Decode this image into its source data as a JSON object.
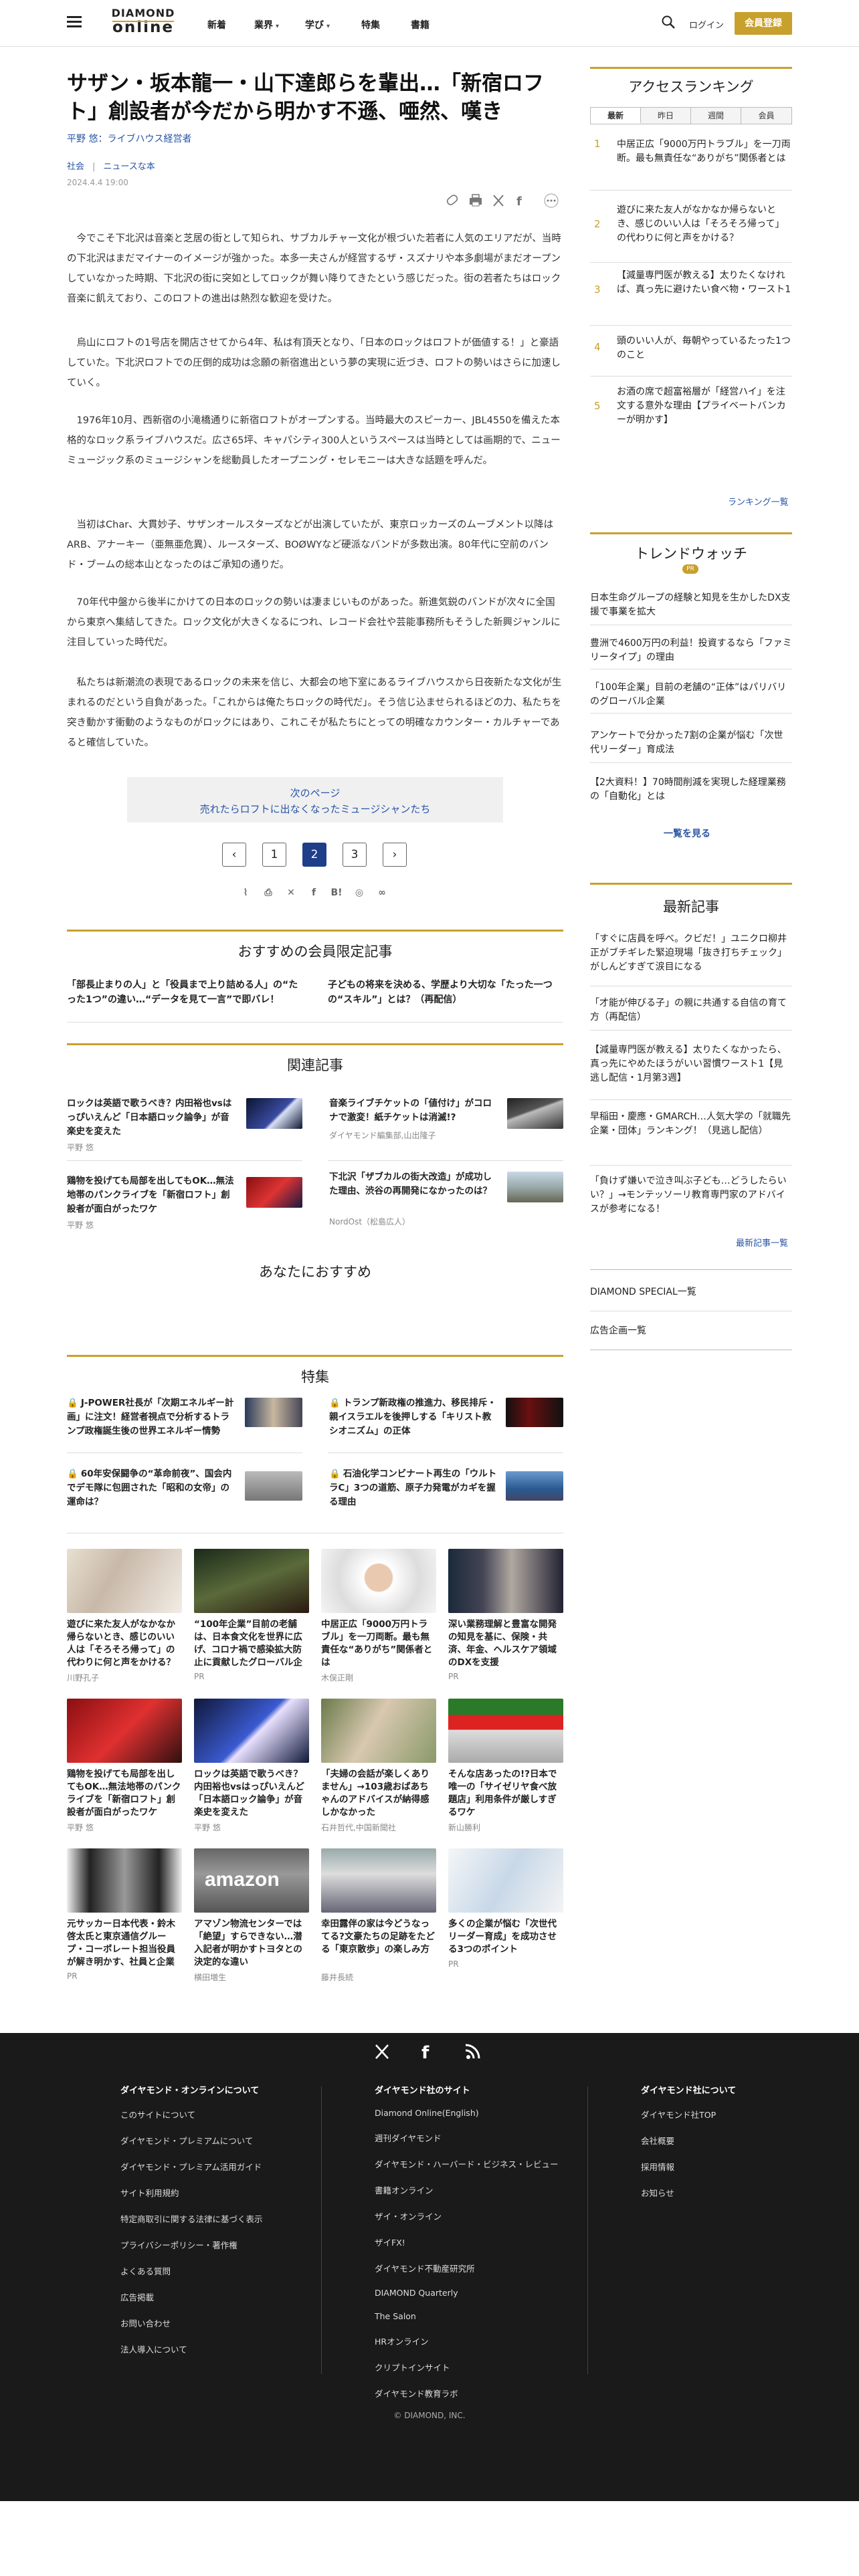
{
  "header": {
    "logo_top": "DIAMOND",
    "logo_bottom": "online",
    "nav": [
      "新着",
      "業界",
      "学び",
      "特集",
      "書籍"
    ],
    "login": "ログイン",
    "register": "会員登録"
  },
  "article": {
    "title": "サザン・坂本龍一・山下達郎らを輩出…「新宿ロフト」創設者が今だから明かす不遜、唖然、嘆き",
    "author": "平野 悠：ライブハウス経営者",
    "categories": [
      "社会",
      "ニュースな本"
    ],
    "date": "2024.4.4 19:00",
    "paragraphs": [
      "今でこそ下北沢は音楽と芝居の街として知られ、サブカルチャー文化が根づいた若者に人気のエリアだが、当時の下北沢はまだマイナーのイメージが強かった。本多一夫さんが経営するザ・スズナリや本多劇場がまだオープンしていなかった時期、下北沢の街に突如としてロックが舞い降りてきたという感じだった。街の若者たちはロック音楽に飢えており、このロフトの進出は熱烈な歓迎を受けた。",
      "烏山にロフトの1号店を開店させてから4年、私は有頂天となり、「日本のロックはロフトが価値する！」と豪語していた。下北沢ロフトでの圧倒的成功は念願の新宿進出という夢の実現に近づき、ロフトの勢いはさらに加速していく。",
      "1976年10月、西新宿の小滝橋通りに新宿ロフトがオープンする。当時最大のスピーカー、JBL4550を備えた本格的なロック系ライブハウスだ。広さ65坪、キャパシティ300人というスペースは当時としては画期的で、ニューミュージック系のミュージシャンを総動員したオープニング・セレモニーは大きな話題を呼んだ。",
      "当初はChar、大貫妙子、サザンオールスターズなどが出演していたが、東京ロッカーズのムーブメント以降はARB、アナーキー（亜無亜危異）、ルースターズ、BOØWYなど硬派なバンドが多数出演。80年代に空前のバンド・ブームの総本山となったのはご承知の通りだ。",
      "70年代中盤から後半にかけての日本のロックの勢いは凄まじいものがあった。新進気鋭のバンドが次々に全国から東京へ集結してきた。ロック文化が大きくなるにつれ、レコード会社や芸能事務所もそうした新興ジャンルに注目していった時代だ。",
      "私たちは新潮流の表現であるロックの未来を信じ、大都会の地下室にあるライブハウスから日夜新たな文化が生まれるのだという自負があった。「これからは俺たちロックの時代だ」。そう信じ込ませられるほどの力、私たちを突き動かす衝動のようなものがロックにはあり、これこそが私たちにとっての明確なカウンター・カルチャーであると確信していた。"
    ],
    "next_label": "次のページ",
    "next_title": "売れたらロフトに出なくなったミュージシャンたち",
    "pages": [
      "1",
      "2",
      "3"
    ],
    "current_page": "2"
  },
  "sections": {
    "members_title": "おすすめの会員限定記事",
    "members": [
      "「部長止まりの人」と「役員まで上り詰める人」の“たった1つ”の違い…“データを見て一言”で即バレ！",
      "子どもの将来を決める、学歴より大切な「たった一つの“スキル”」とは？（再配信）"
    ],
    "related_title": "関連記事",
    "related": [
      {
        "title": "ロックは英語で歌うべき？内田裕也vsはっぴいえんど「日本語ロック論争」が音楽史を変えた",
        "sub": "平野 悠"
      },
      {
        "title": "音楽ライブチケットの「値付け」がコロナで激変！紙チケットは消滅!?",
        "sub": "ダイヤモンド編集部,山出隆子"
      },
      {
        "title": "鶏物を投げても局部を出してもOK…無法地帯のパンクライブを「新宿ロフト」創設者が面白がったワケ",
        "sub": "平野 悠"
      },
      {
        "title": "下北沢「ザブカルの街大改造」が成功した理由、渋谷の再開発になかったのは？",
        "sub": "NordOst（松島広人）"
      }
    ],
    "recommend_title": "あなたにおすすめ",
    "special_title": "特集",
    "special": [
      "J-POWER社長が「次期エネルギー計画」に注文！経営者視点で分析するトランプ政権誕生後の世界エネルギー情勢",
      "トランプ新政権の推進力、移民排斥・親イスラエルを後押しする「キリスト教シオニズム」の正体",
      "60年安保闘争の“革命前夜”、国会内でデモ隊に包囲された「昭和の女帝」の運命は？",
      "石油化学コンビナート再生の「ウルトラC」3つの道筋、原子力発電がカギを握る理由"
    ],
    "grid": [
      {
        "t": "遊びに来た友人がなかなか帰らないとき、感じのいい人は「そろそろ帰って」の代わりに何と声をかける？",
        "s": "川野孔子"
      },
      {
        "t": "“100年企業”目前の老舗は、日本食文化を世界に広げ、コロナ禍で感染拡大防止に貢献したグローバル企",
        "s": "PR"
      },
      {
        "t": "中居正広「9000万円トラブル」を一刀両断。最も無責任な“ありがち”関係者とは",
        "s": "木俣正剛"
      },
      {
        "t": "深い業務理解と豊富な開発の知見を基に、保険・共済、年金、ヘルスケア領域のDXを支援",
        "s": "PR"
      },
      {
        "t": "鶏物を投げても局部を出してもOK…無法地帯のパンクライブを「新宿ロフト」創設者が面白がったワケ",
        "s": "平野 悠"
      },
      {
        "t": "ロックは英語で歌うべき？内田裕也vsはっぴいえんど「日本語ロック論争」が音楽史を変えた",
        "s": "平野 悠"
      },
      {
        "t": "「夫婦の会話が楽しくありません」→103歳おばあちゃんのアドバイスが納得感しかなかった",
        "s": "石井哲代,中国新聞社"
      },
      {
        "t": "そんな店あったの!?日本で唯一の「サイゼリヤ食べ放題店」利用条件が厳しすぎるワケ",
        "s": "新山勝利"
      },
      {
        "t": "元サッカー日本代表・鈴木啓太氏と東京通信グループ・コーポレート担当役員が解き明かす、社員と企業が共",
        "s": "PR"
      },
      {
        "t": "アマゾン物流センターでは「絶望」すらできない…潜入記者が明かすトヨタとの決定的な違い",
        "s": "横田増生"
      },
      {
        "t": "幸田露伴の家は今どうなってる?文豪たちの足跡をたどる「東京散歩」の楽しみ方",
        "s": "藤井長続"
      },
      {
        "t": "多くの企業が悩む「次世代リーダー育成」を成功させる3つのポイント",
        "s": "PR"
      }
    ]
  },
  "sidebar": {
    "ranking_title": "アクセスランキング",
    "tabs": [
      "最新",
      "昨日",
      "週間",
      "会員"
    ],
    "ranking": [
      "中居正広「9000万円トラブル」を一刀両断。最も無責任な“ありがち”関係者とは",
      "遊びに来た友人がなかなか帰らないとき、感じのいい人は「そろそろ帰って」の代わりに何と声をかける？",
      "【減量専門医が教える】太りたくなければ、真っ先に避けたい食べ物・ワースト1",
      "頭のいい人が、毎朝やっているたった1つのこと",
      "お酒の席で超富裕層が「経営ハイ」を注文する意外な理由【プライベートバンカーが明かす】"
    ],
    "ranking_more": "ランキング一覧",
    "trend_title": "トレンドウォッチ",
    "trend_badge": "PR",
    "trend": [
      "日本生命グループの経験と知見を生かしたDX支援で事業を拡大",
      "豊洲で4600万円の利益！投資するなら「ファミリータイプ」の理由",
      "「100年企業」目前の老舗の“正体”はパリバリのグローバル企業",
      "アンケートで分かった7割の企業が悩む「次世代リーダー」育成法",
      "【2大資料！】70時間削減を実現した経理業務の「自動化」とは"
    ],
    "trend_more": "一覧を見る",
    "latest_title": "最新記事",
    "latest": [
      "「すぐに店員を呼べ。クビだ！」ユニクロ柳井正がブチギレた緊迫現場「抜き打ちチェック」がしんどすぎて涙目になる",
      "「才能が伸びる子」の親に共通する自信の育て方（再配信）",
      "【減量専門医が教える】太りたくなかったら、真っ先にやめたほうがいい習慣ワースト1【見逃し配信・1月第3週】",
      "早稲田・慶應・GMARCH…人気大学の「就職先企業・団体」ランキング！（見逃し配信）",
      "「負けず嫌いで泣き叫ぶ子ども…どうしたらいい？」→モンテッソーリ教育専門家のアドバイスが参考になる！"
    ],
    "latest_more": "最新記事一覧",
    "links": [
      "DIAMOND SPECIAL一覧",
      "広告企画一覧"
    ]
  },
  "footer": {
    "col1_title": "ダイヤモンド・オンラインについて",
    "col1": [
      "このサイトについて",
      "ダイヤモンド・プレミアムについて",
      "ダイヤモンド・プレミアム活用ガイド",
      "サイト利用規約",
      "特定商取引に関する法律に基づく表示",
      "プライバシーポリシー・著作権",
      "よくある質問",
      "広告掲載",
      "お問い合わせ",
      "法人導入について"
    ],
    "col2_title": "ダイヤモンド社のサイト",
    "col2": [
      "Diamond Online(English)",
      "週刊ダイヤモンド",
      "ダイヤモンド・ハーバード・ビジネス・レビュー",
      "書籍オンライン",
      "ザイ・オンライン",
      "ザイFX!",
      "ダイヤモンド不動産研究所",
      "DIAMOND Quarterly",
      "The Salon",
      "HRオンライン",
      "クリプトインサイト",
      "ダイヤモンド教育ラボ"
    ],
    "col3_title": "ダイヤモンド社について",
    "col3": [
      "ダイヤモンド社TOP",
      "会社概要",
      "採用情報",
      "お知らせ"
    ],
    "copyright": "© DIAMOND, INC."
  },
  "colors": {
    "gold": "#c8a02c",
    "navy": "#1f3e8a",
    "link": "#2a55a5",
    "footer": "#1a1a1a"
  }
}
